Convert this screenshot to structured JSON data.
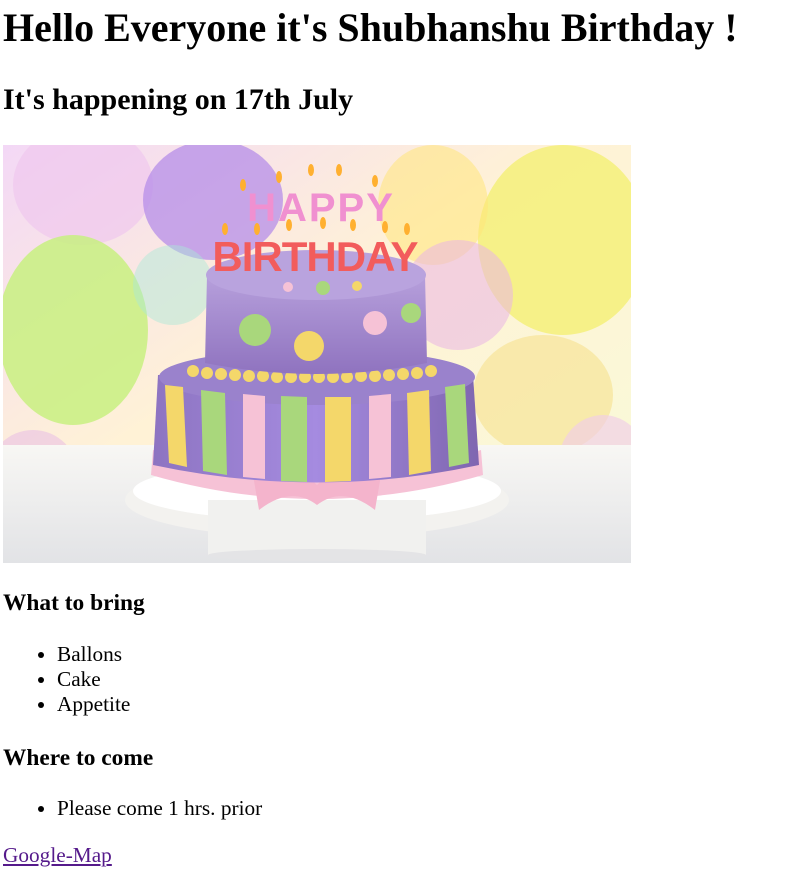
{
  "page": {
    "main_heading": "Hello Everyone it's Shubhanshu Birthday !",
    "date_heading": "It's happening on 17th July",
    "hero_image": {
      "top_word": "HAPPY",
      "bottom_word": "BIRTHDAY",
      "colors": {
        "cake_purple": "#a98fd1",
        "cake_yellow": "#f4d76a",
        "cake_green": "#a9d77c",
        "ribbon_pink": "#f6c2d6",
        "balloon_purple": "#b58ee8",
        "balloon_yellow": "#f5f07a",
        "balloon_green": "#c8f080"
      }
    },
    "bring": {
      "heading": "What to bring",
      "items": [
        "Ballons",
        "Cake",
        "Appetite"
      ]
    },
    "come": {
      "heading": "Where to come",
      "items": [
        "Please come 1 hrs. prior"
      ]
    },
    "map_link": {
      "label": "Google-Map"
    }
  }
}
